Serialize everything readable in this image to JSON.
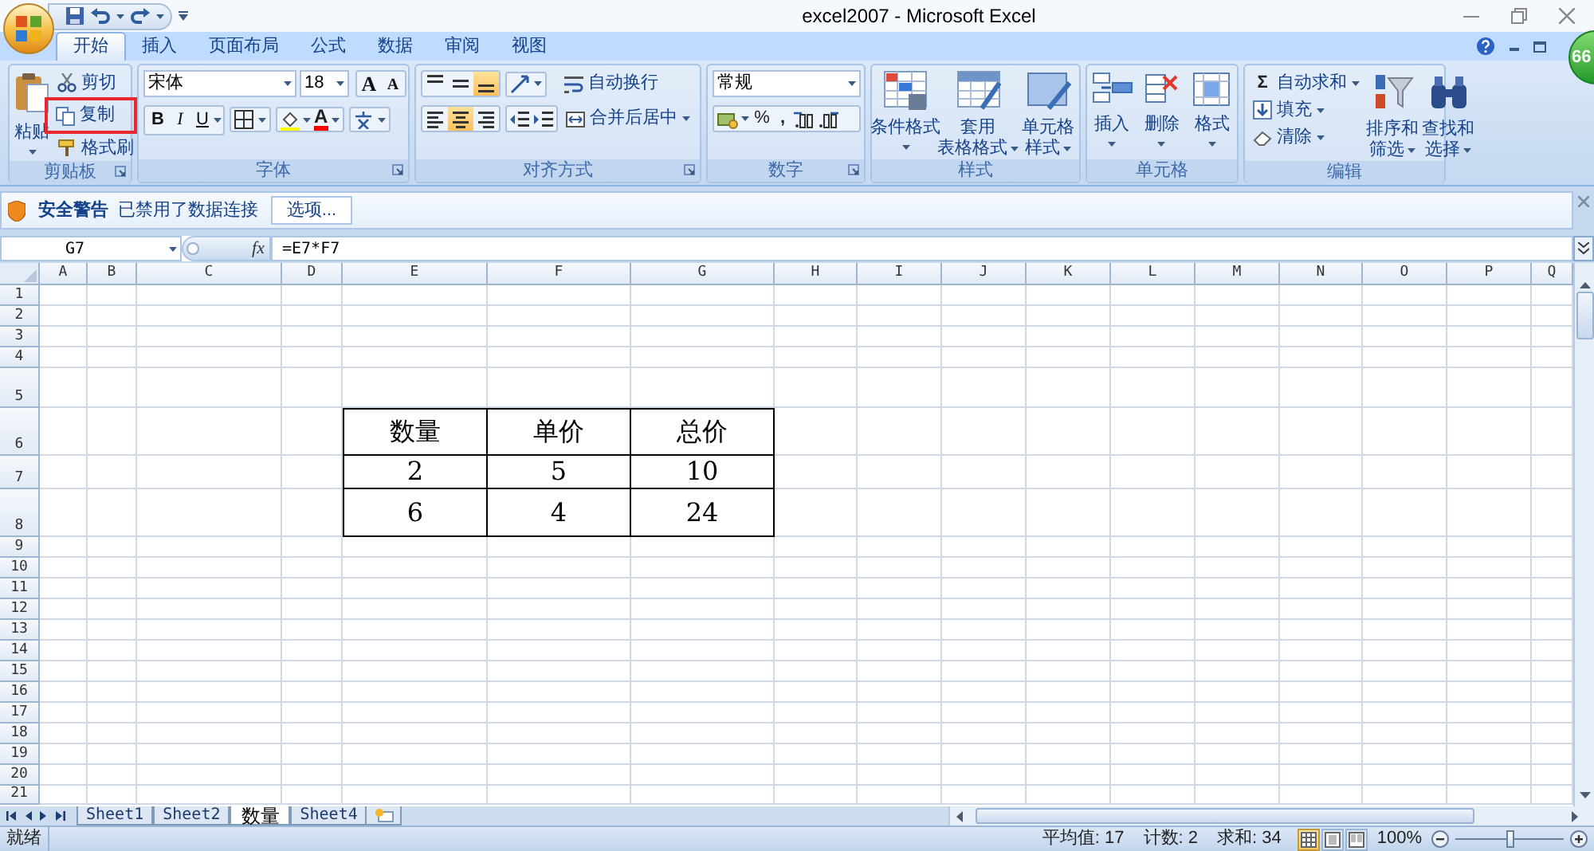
{
  "window": {
    "title": "excel2007 - Microsoft Excel"
  },
  "badge": {
    "text": "66"
  },
  "tabs": [
    {
      "label": "开始",
      "selected": true
    },
    {
      "label": "插入",
      "selected": false
    },
    {
      "label": "页面布局",
      "selected": false
    },
    {
      "label": "公式",
      "selected": false
    },
    {
      "label": "数据",
      "selected": false
    },
    {
      "label": "审阅",
      "selected": false
    },
    {
      "label": "视图",
      "selected": false
    }
  ],
  "ribbon": {
    "clipboard": {
      "label": "剪贴板",
      "paste": "粘贴",
      "commands": [
        "剪切",
        "复制",
        "格式刷"
      ]
    },
    "font": {
      "label": "字体",
      "font_name": "宋体",
      "font_size": "18",
      "size_buttons": [
        "A",
        "A"
      ],
      "style_buttons": [
        "B",
        "I",
        "U"
      ],
      "font_color_letter": "A"
    },
    "alignment": {
      "label": "对齐方式",
      "vertical": [
        {
          "selected": false
        },
        {
          "selected": false
        },
        {
          "selected": true
        }
      ],
      "horizontal": [
        {
          "selected": false
        },
        {
          "selected": true
        },
        {
          "selected": false
        }
      ],
      "wrap_text": "自动换行",
      "merge_center": "合并后居中"
    },
    "number": {
      "label": "数字",
      "format": "常规",
      "symbols": [
        "%",
        ","
      ]
    },
    "styles": {
      "label": "样式",
      "buttons": [
        {
          "lines": [
            "条件格式"
          ]
        },
        {
          "lines": [
            "套用",
            "表格格式"
          ]
        },
        {
          "lines": [
            "单元格",
            "样式"
          ]
        }
      ]
    },
    "cells": {
      "label": "单元格",
      "buttons": [
        {
          "lines": [
            "插入"
          ]
        },
        {
          "lines": [
            "删除"
          ]
        },
        {
          "lines": [
            "格式"
          ]
        }
      ]
    },
    "editing": {
      "label": "编辑",
      "autosum_symbol": "Σ",
      "commands": [
        "自动求和",
        "填充",
        "清除"
      ],
      "buttons": [
        {
          "lines": [
            "排序和",
            "筛选"
          ]
        },
        {
          "lines": [
            "查找和",
            "选择"
          ]
        }
      ]
    }
  },
  "security_bar": {
    "title": "安全警告",
    "message": "已禁用了数据连接",
    "button": "选项..."
  },
  "formula_bar": {
    "name_box": "G7",
    "fx": "fx",
    "formula": "=E7*F7"
  },
  "sheet": {
    "columns": [
      "A",
      "B",
      "C",
      "D",
      "E",
      "F",
      "G",
      "H",
      "I",
      "J",
      "K",
      "L",
      "M",
      "N",
      "O",
      "P",
      "Q"
    ],
    "rows": [
      "1",
      "2",
      "3",
      "4",
      "5",
      "6",
      "7",
      "8",
      "9",
      "10",
      "11",
      "12",
      "13",
      "14",
      "15",
      "16",
      "17",
      "18",
      "19",
      "20",
      "21"
    ],
    "table": [
      [
        "数量",
        "单价",
        "总价"
      ],
      [
        "2",
        "5",
        "10"
      ],
      [
        "6",
        "4",
        "24"
      ]
    ]
  },
  "sheet_tabs": [
    {
      "label": "Sheet1",
      "selected": false
    },
    {
      "label": "Sheet2",
      "selected": false
    },
    {
      "label": "数量",
      "selected": true
    },
    {
      "label": "Sheet4",
      "selected": false
    }
  ],
  "status_bar": {
    "ready": "就绪",
    "stats": [
      "平均值: 17",
      "计数: 2",
      "求和: 34"
    ],
    "views": [
      {
        "selected": true
      },
      {
        "selected": false
      },
      {
        "selected": false
      }
    ],
    "zoom": "100%",
    "zoom_slider": {
      "level": 0.5
    }
  }
}
